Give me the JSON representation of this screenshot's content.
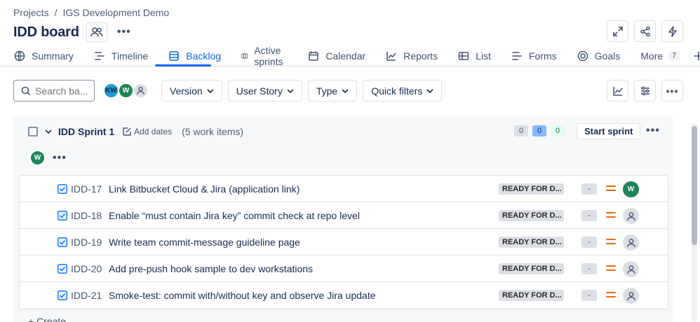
{
  "breadcrumb": {
    "projects": "Projects",
    "separator": "/",
    "project": "IGS Development Demo"
  },
  "page": {
    "title": "IDD board"
  },
  "tabs": [
    {
      "label": "Summary",
      "icon": "globe-icon"
    },
    {
      "label": "Timeline",
      "icon": "timeline-icon"
    },
    {
      "label": "Backlog",
      "icon": "backlog-icon",
      "active": true
    },
    {
      "label": "Active sprints",
      "icon": "board-icon"
    },
    {
      "label": "Calendar",
      "icon": "calendar-icon"
    },
    {
      "label": "Reports",
      "icon": "chart-line-icon"
    },
    {
      "label": "List",
      "icon": "list-icon"
    },
    {
      "label": "Forms",
      "icon": "form-icon"
    },
    {
      "label": "Goals",
      "icon": "target-icon"
    }
  ],
  "more_tab": {
    "label": "More",
    "count": "7"
  },
  "filters": {
    "search_placeholder": "Search ba...",
    "avatars": [
      "KW",
      "W",
      ""
    ],
    "dropdowns": [
      "Version",
      "User Story",
      "Type",
      "Quick filters"
    ]
  },
  "sprint": {
    "name": "IDD Sprint 1",
    "add_dates": "Add dates",
    "work_count": "(5 work items)",
    "counts": {
      "todo": "0",
      "in_progress": "0",
      "done": "0"
    },
    "start_label": "Start sprint",
    "assignee_avatar": "W"
  },
  "issues": [
    {
      "key": "IDD-17",
      "summary": "Link Bitbucket Cloud & Jira (application link)",
      "status": "READY FOR D...",
      "estimate": "-",
      "assignee": "W"
    },
    {
      "key": "IDD-18",
      "summary": "Enable “must contain Jira key” commit check at repo level",
      "status": "READY FOR D...",
      "estimate": "-",
      "assignee": ""
    },
    {
      "key": "IDD-19",
      "summary": "Write team commit-message guideline page",
      "status": "READY FOR D...",
      "estimate": "-",
      "assignee": ""
    },
    {
      "key": "IDD-20",
      "summary": "Add pre-push hook sample to dev workstations",
      "status": "READY FOR D...",
      "estimate": "-",
      "assignee": ""
    },
    {
      "key": "IDD-21",
      "summary": "Smoke-test: commit with/without key and observe Jira update",
      "status": "READY FOR D...",
      "estimate": "-",
      "assignee": ""
    }
  ],
  "colors": {
    "accent": "#0c66e4",
    "priority_medium": "#e56910",
    "avatar_green": "#1f845a",
    "avatar_blue": "#1d9bd1"
  },
  "create_label": "+ Create"
}
